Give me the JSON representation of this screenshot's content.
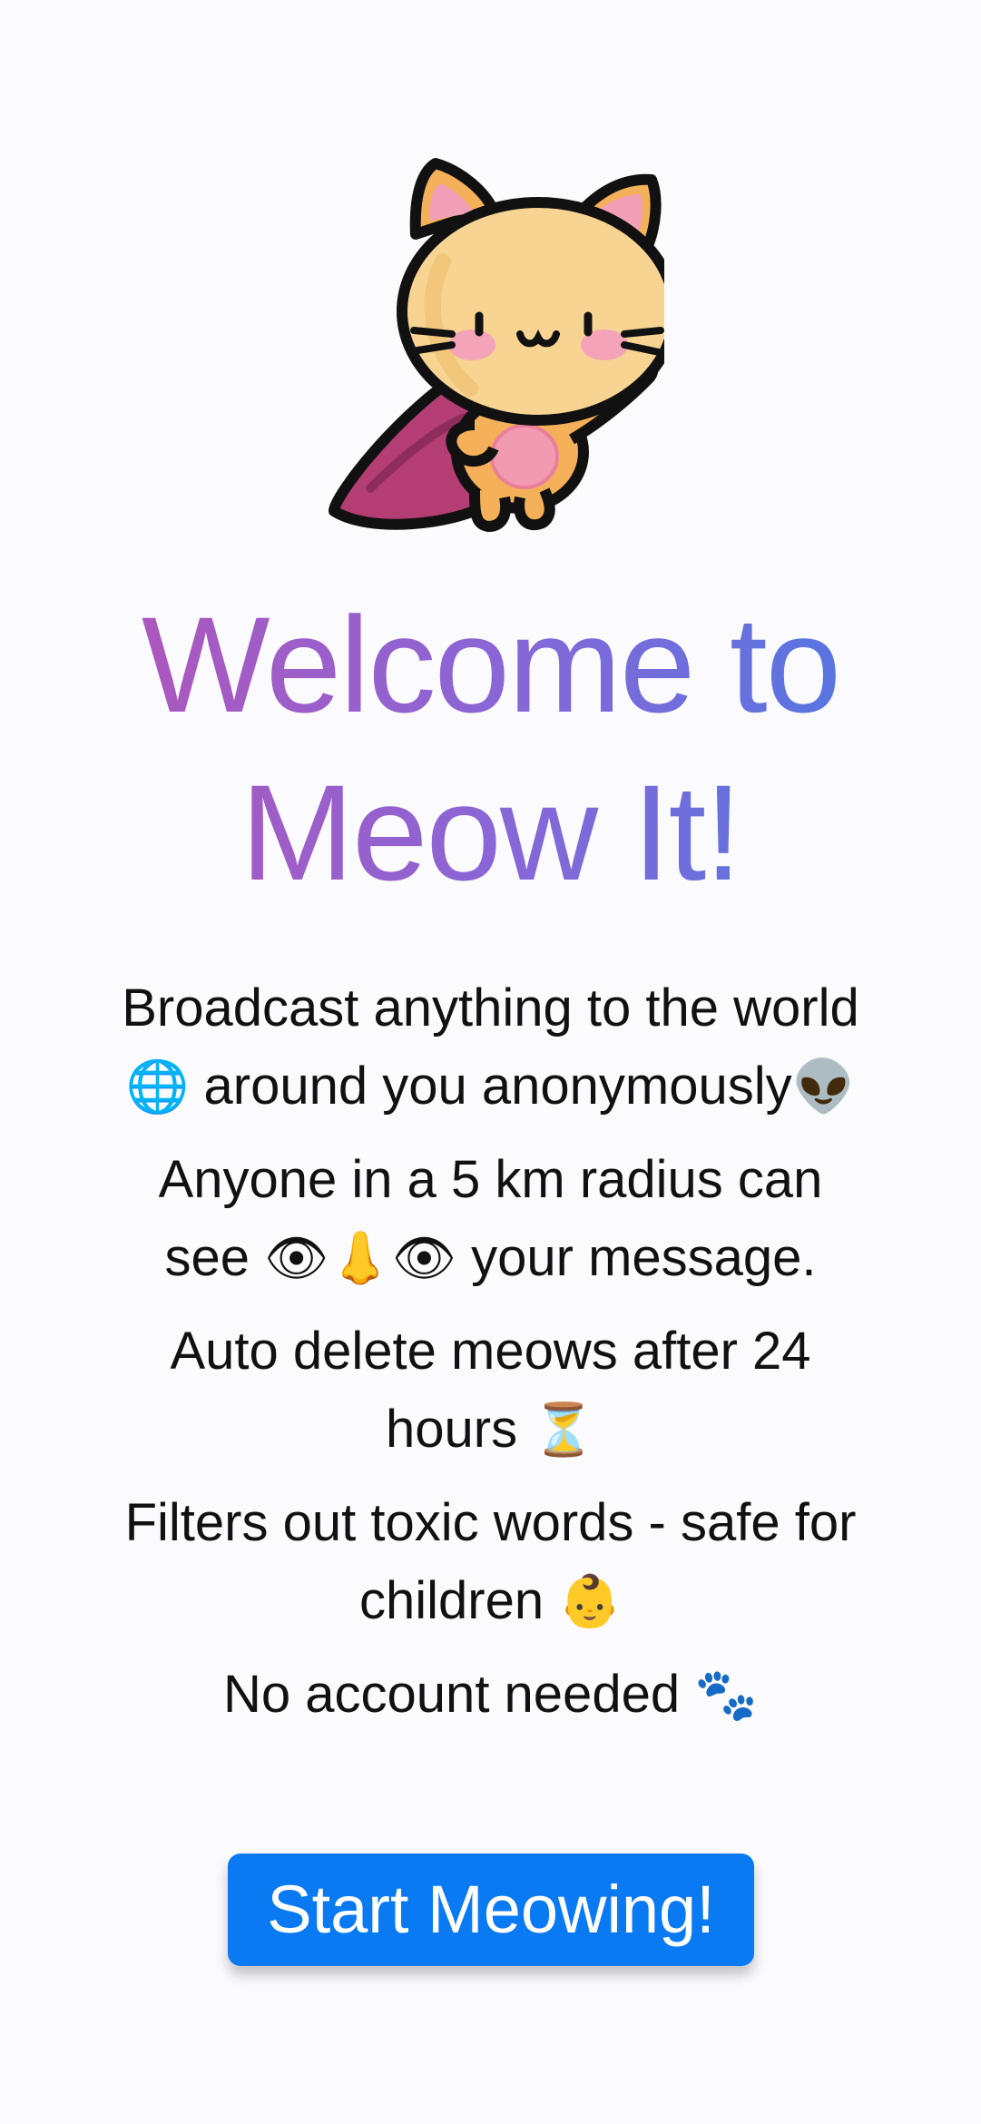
{
  "mascot": {
    "icon": "superhero-cat-icon"
  },
  "title_line1": "Welcome to",
  "title_line2": "Meow It!",
  "features": [
    {
      "text": "Broadcast anything to the world",
      "emoji": "🌐",
      "text_after": "around you anonymously",
      "emoji_after": "👽"
    },
    {
      "text": "Anyone in a 5 km radius can see",
      "emoji": "👁👃👁",
      "text_after": "your message."
    },
    {
      "text": "Auto delete meows after 24 hours",
      "emoji": "⏳"
    },
    {
      "text": "Filters out toxic words - safe for children",
      "emoji": "👶"
    },
    {
      "text": "No account needed",
      "emoji": "🐾"
    }
  ],
  "start_button_label": "Start Meowing!",
  "colors": {
    "title_gradient_start": "#b454b8",
    "title_gradient_end": "#4c79e4",
    "button": "#0a7af3",
    "button_text": "#ffffff"
  }
}
